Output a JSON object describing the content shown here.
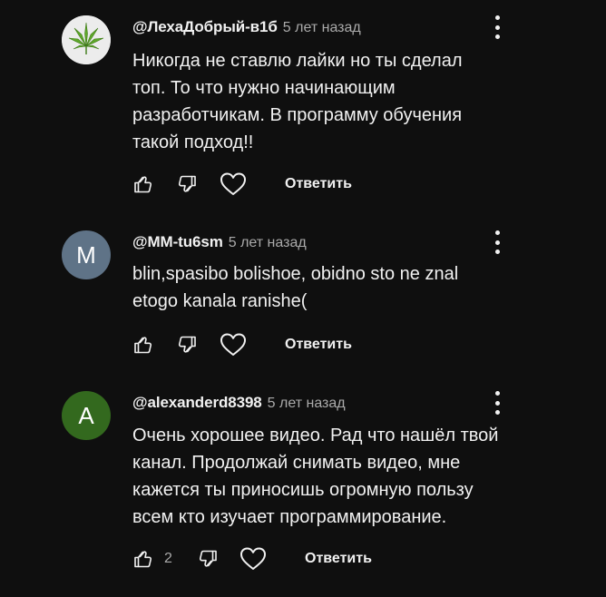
{
  "comments": [
    {
      "author": "@ЛехаДобрый-в1б",
      "time": "5 лет назад",
      "avatar": {
        "type": "image",
        "icon": "cannabis-leaf-icon",
        "letter": ""
      },
      "lines": [
        "Никогда не ставлю лайки но ты сделал",
        "топ. То что нужно начинающим",
        "разработчикам. В программу обучения",
        "такой подход!!"
      ],
      "likes": "",
      "reply_label": "Ответить"
    },
    {
      "author": "@MM-tu6sm",
      "time": "5 лет назад",
      "avatar": {
        "type": "letter",
        "letter": "M",
        "color": "#5f7387"
      },
      "lines": [
        "blin,spasibo bolishoe, obidno sto ne znal",
        "etogo kanala ranishe("
      ],
      "likes": "",
      "reply_label": "Ответить"
    },
    {
      "author": "@alexanderd8398",
      "time": "5 лет назад",
      "avatar": {
        "type": "letter",
        "letter": "A",
        "color": "#33691e"
      },
      "lines": [
        "Очень хорошее видео. Рад что нашёл твой",
        "канал. Продолжай снимать видео, мне",
        "кажется ты приносишь огромную пользу",
        "всем кто изучает программирование."
      ],
      "likes": "2",
      "reply_label": "Ответить"
    }
  ]
}
